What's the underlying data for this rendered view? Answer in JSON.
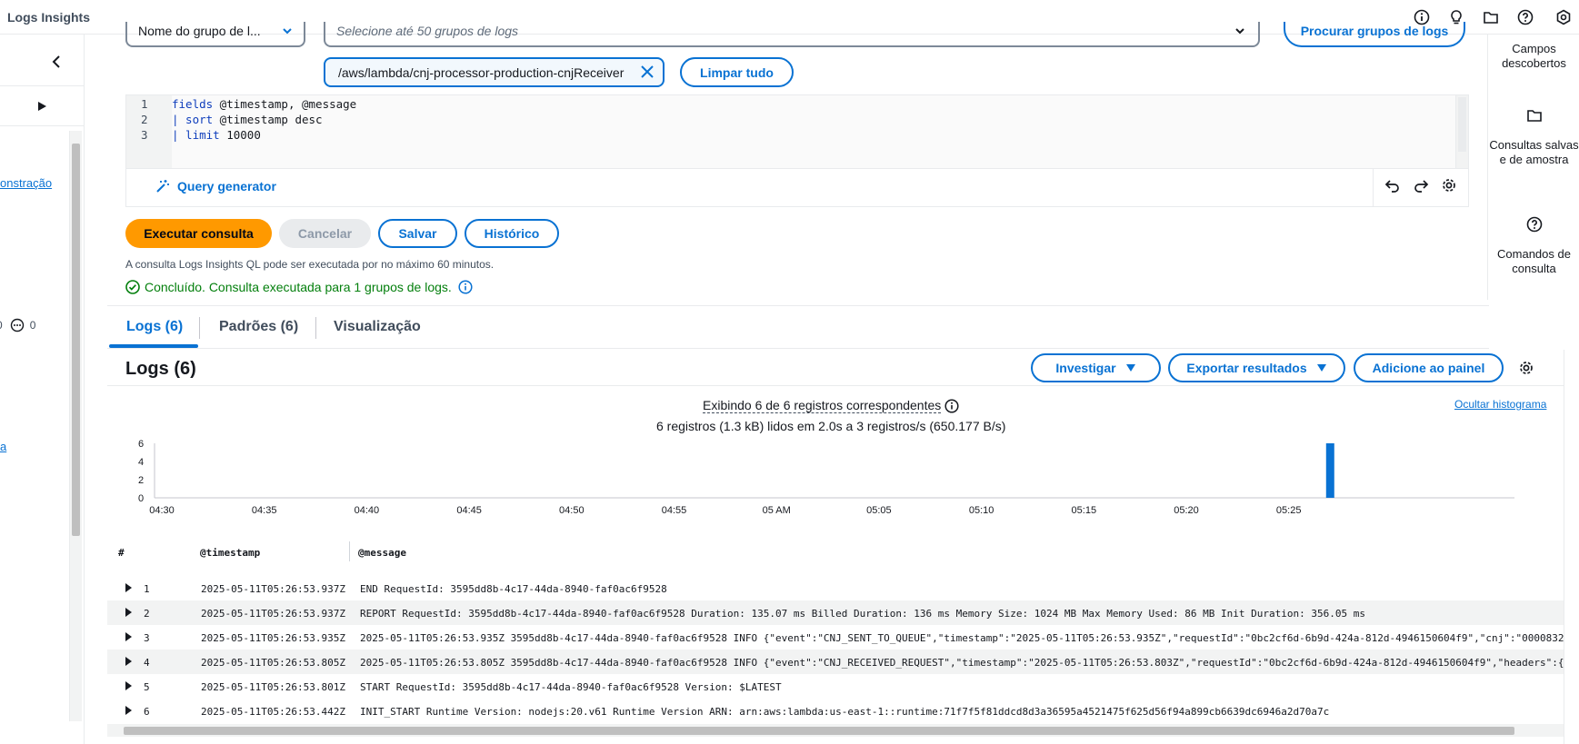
{
  "topbar": {
    "title": "Logs Insights",
    "icons": [
      "info-icon",
      "lightbulb-icon",
      "folder-icon",
      "help-icon",
      "settings-icon"
    ]
  },
  "leftnav": {
    "link1": "onstração",
    "link2": "a",
    "count_a": "0",
    "count_b": "0"
  },
  "query": {
    "group_select": "Nome do grupo de l...",
    "log_select_placeholder": "Selecione até 50 grupos de logs",
    "browse_button": "Procurar grupos de logs",
    "token": "/aws/lambda/cnj-processor-production-cnjReceiver",
    "clear_all": "Limpar tudo",
    "lines": [
      {
        "n": "1",
        "kw": "fields",
        "rest": " @timestamp, @message"
      },
      {
        "n": "2",
        "kw": "| sort",
        "rest": " @timestamp desc"
      },
      {
        "n": "3",
        "kw": "| limit",
        "rest": " 10000"
      }
    ],
    "query_generator": "Query generator",
    "run": "Executar consulta",
    "cancel": "Cancelar",
    "save": "Salvar",
    "history": "Histórico",
    "help_text": "A consulta Logs Insights QL pode ser executada por no máximo 60 minutos.",
    "status": "Concluído. Consulta executada para 1 grupos de logs."
  },
  "rightpanel": {
    "fields": "Campos descobertos",
    "saved": "Consultas salvas e de amostra",
    "commands": "Comandos de consulta"
  },
  "tabs": [
    {
      "label": "Logs (6)",
      "active": true
    },
    {
      "label": "Padrões (6)",
      "active": false
    },
    {
      "label": "Visualização",
      "active": false
    }
  ],
  "results": {
    "title": "Logs (6)",
    "investigate": "Investigar",
    "export": "Exportar resultados",
    "add_dashboard": "Adicione ao painel",
    "summary_line1": "Exibindo 6 de 6 registros correspondentes",
    "summary_line2": "6 registros (1.3 kB) lidos em 2.0s a 3 registros/s (650.177 B/s)",
    "hide_histogram": "Ocultar histograma"
  },
  "chart_data": {
    "type": "bar",
    "categories": [
      "04:30",
      "04:35",
      "04:40",
      "04:45",
      "04:50",
      "04:55",
      "05 AM",
      "05:05",
      "05:10",
      "05:15",
      "05:20",
      "05:25"
    ],
    "series": [
      {
        "x": "05:27",
        "value": 6
      }
    ],
    "y_ticks": [
      "0",
      "2",
      "4",
      "6"
    ],
    "ylim": [
      0,
      6
    ],
    "color": "#0972d3"
  },
  "table": {
    "headers": [
      "#",
      "@timestamp",
      "@message"
    ],
    "rows": [
      {
        "n": "1",
        "ts": "2025-05-11T05:26:53.937Z",
        "msg": "END RequestId: 3595dd8b-4c17-44da-8940-faf0ac6f9528"
      },
      {
        "n": "2",
        "ts": "2025-05-11T05:26:53.937Z",
        "msg": "REPORT RequestId: 3595dd8b-4c17-44da-8940-faf0ac6f9528 Duration: 135.07 ms Billed Duration: 136 ms Memory Size: 1024 MB Max Memory Used: 86 MB Init Duration: 356.05 ms"
      },
      {
        "n": "3",
        "ts": "2025-05-11T05:26:53.935Z",
        "msg": "2025-05-11T05:26:53.935Z 3595dd8b-4c17-44da-8940-faf0ac6f9528 INFO {\"event\":\"CNJ_SENT_TO_QUEUE\",\"timestamp\":\"2025-05-11T05:26:53.935Z\",\"requestId\":\"0bc2cf6d-6b9d-424a-812d-4946150604f9\",\"cnj\":\"0000832"
      },
      {
        "n": "4",
        "ts": "2025-05-11T05:26:53.805Z",
        "msg": "2025-05-11T05:26:53.805Z 3595dd8b-4c17-44da-8940-faf0ac6f9528 INFO {\"event\":\"CNJ_RECEIVED_REQUEST\",\"timestamp\":\"2025-05-11T05:26:53.803Z\",\"requestId\":\"0bc2cf6d-6b9d-424a-812d-4946150604f9\",\"headers\":{"
      },
      {
        "n": "5",
        "ts": "2025-05-11T05:26:53.801Z",
        "msg": "START RequestId: 3595dd8b-4c17-44da-8940-faf0ac6f9528 Version: $LATEST"
      },
      {
        "n": "6",
        "ts": "2025-05-11T05:26:53.442Z",
        "msg": "INIT_START Runtime Version: nodejs:20.v61 Runtime Version ARN: arn:aws:lambda:us-east-1::runtime:71f7f5f81ddcd8d3a36595a4521475f625d56f94a899cb6639dc6946a2d70a7c"
      }
    ]
  }
}
